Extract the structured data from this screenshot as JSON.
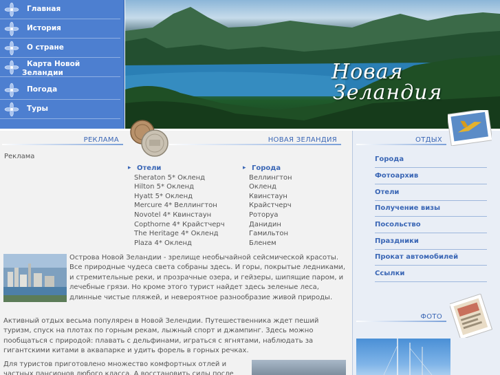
{
  "nav": {
    "items": [
      {
        "label": "Главная"
      },
      {
        "label": "История"
      },
      {
        "label": "О стране"
      },
      {
        "label": "Карта Новой Зеландии"
      },
      {
        "label": "Погода"
      },
      {
        "label": "Туры"
      }
    ]
  },
  "banner": {
    "title_line1": "Новая",
    "title_line2": "Зеландия"
  },
  "sections": {
    "ads_header": "РЕКЛАМА",
    "nz_header": "НОВАЯ ЗЕЛАНДИЯ",
    "rest_header": "ОТДЫХ",
    "photo_header": "ФОТО"
  },
  "ads_label": "Реклама",
  "hotels": {
    "heading": "Отели",
    "items": [
      "Sheraton 5* Окленд",
      "Hilton 5* Окленд",
      "Hyatt 5* Окленд",
      "Mercure 4* Веллингтон",
      "Novotel 4* Квинстаун",
      "Copthorne 4* Крайстчерч",
      "The Heritage 4* Окленд",
      "Plaza 4* Окленд"
    ]
  },
  "cities": {
    "heading": "Города",
    "items": [
      "Веллингтон",
      "Окленд",
      "Квинстаун",
      "Крайстчерч",
      "Роторуа",
      "Данидин",
      "Гамильтон",
      "Бленем"
    ]
  },
  "content": {
    "p1": "Острова Новой Зеландии - зрелище необычайной сейсмической красоты. Все природные чудеса света собраны здесь. И горы, покрытые ледниками, и стремительные реки, и прозрачные озера, и гейзеры, шипящие паром, и лечебные грязи. Но кроме этого турист найдет здесь зеленые леса, длинные чистые пляжей, и невероятное разнообразие живой природы.",
    "p2": "Активный отдых весьма популярен в Новой Зелендии. Путешественника ждет пеший туризм, спуск на плотах по горным рекам, лыжный спорт и джампинг. Здесь можно пообщаться с природой: плавать с дельфинами, играться с ягнятами, наблюдать за гигантскими китами в аквапарке и удить форель в горных речках.",
    "p3": "Для туристов приготовлено множество комфортных отлей и частных пансионов любого класса. А восстановить силы после"
  },
  "right_nav": {
    "items": [
      "Города",
      "Фотоархив",
      "Отели",
      "Получение визы",
      "Посольство",
      "Праздники",
      "Прокат автомобилей",
      "Ссылки"
    ]
  },
  "colors": {
    "nav_bg": "#4d7fd0",
    "accent": "#3a66b5",
    "main_bg": "#f2f2f2",
    "right_bg": "#e9eef6"
  }
}
